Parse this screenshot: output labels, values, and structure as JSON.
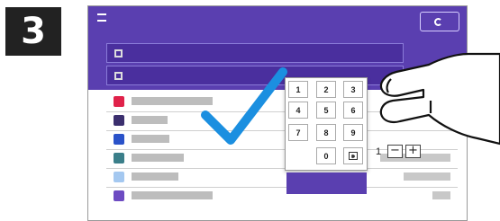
{
  "step": {
    "number": "3"
  },
  "topbar": {
    "left_label": "",
    "title": "",
    "right_label": ""
  },
  "header_rows": [
    {
      "label": ""
    },
    {
      "label": ""
    }
  ],
  "list_items": [
    {
      "icon_color": "#e0224a",
      "label": "",
      "value": ""
    },
    {
      "icon_color": "#3b2f6e",
      "label": "",
      "value": ""
    },
    {
      "icon_color": "#2a52c9",
      "label": "",
      "value": ""
    },
    {
      "icon_color": "#3b7f8a",
      "label": "",
      "value": ""
    },
    {
      "icon_color": "#a4c8f0",
      "label": "",
      "value": ""
    },
    {
      "icon_color": "#6d4bc2",
      "label": "",
      "value": ""
    }
  ],
  "quantity": {
    "value": "1",
    "minus": "−",
    "plus": "+"
  },
  "keypad": {
    "keys": [
      "1",
      "2",
      "3",
      "4",
      "5",
      "6",
      "7",
      "8",
      "9",
      "0"
    ],
    "backspace_icon": "backspace-icon",
    "enter_label": ""
  },
  "colors": {
    "accent": "#5a3fb0",
    "check": "#1b8fe0"
  }
}
